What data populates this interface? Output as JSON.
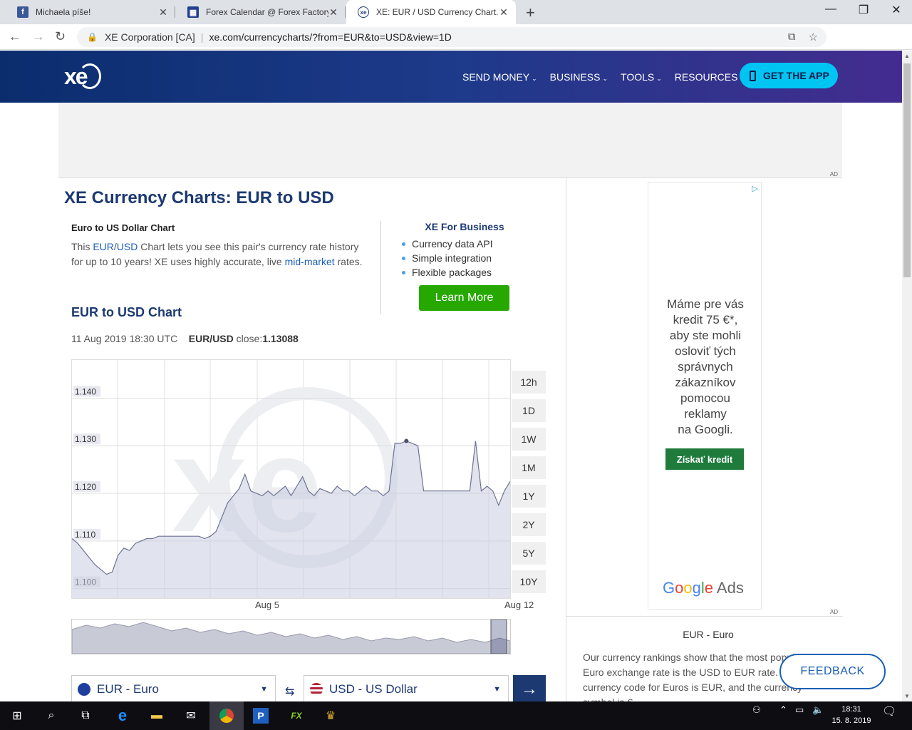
{
  "browser": {
    "tabs": [
      {
        "title": "Michaela píše!",
        "icon": "facebook-icon",
        "color": "#3b5998"
      },
      {
        "title": "Forex Calendar @ Forex Factory",
        "icon": "forexfactory-icon",
        "color": "#243f8f"
      },
      {
        "title": "XE: EUR / USD Currency Chart. Eu",
        "icon": "xe-icon",
        "color": "#1c3972"
      }
    ],
    "active_tab": 2,
    "org": "XE Corporation [CA]",
    "url": "xe.com/currencycharts/?from=EUR&to=USD&view=1D"
  },
  "header": {
    "logo": "xe",
    "nav": [
      "SEND MONEY",
      "BUSINESS",
      "TOOLS",
      "RESOURCES"
    ],
    "cta": "GET THE APP"
  },
  "ad_label": "AD",
  "main": {
    "title": "XE Currency Charts: EUR to USD",
    "intro_heading": "Euro to US Dollar Chart",
    "intro_pre": "This ",
    "intro_link1": "EUR",
    "intro_slash": "/",
    "intro_link2": "USD",
    "intro_mid": " Chart lets you see this pair's currency rate history for up to 10 years! XE uses highly accurate, live ",
    "intro_link3": "mid-market",
    "intro_post": " rates.",
    "business": {
      "title": "XE For Business",
      "items": [
        "Currency data API",
        "Simple integration",
        "Flexible packages"
      ],
      "button": "Learn More"
    },
    "chart_heading": "EUR to USD Chart",
    "meta_time": "11 Aug 2019 18:30 UTC",
    "meta_pair": "EUR/USD",
    "meta_close_label": " close:",
    "meta_close_value": "1.13088",
    "range_buttons": [
      "12h",
      "1D",
      "1W",
      "1M",
      "1Y",
      "2Y",
      "5Y",
      "10Y"
    ],
    "from_currency": "EUR - Euro",
    "to_currency": "USD - US Dollar"
  },
  "chart_data": {
    "type": "area",
    "yticks": [
      "1.140",
      "1.130",
      "1.120",
      "1.110",
      "1.100"
    ],
    "ylim": [
      1.098,
      1.148
    ],
    "xlabels": [
      "Aug 5",
      "Aug 12"
    ],
    "series": [
      {
        "values": [
          1.1105,
          1.1095,
          1.108,
          1.1065,
          1.105,
          1.104,
          1.103,
          1.1035,
          1.107,
          1.1085,
          1.108,
          1.1095,
          1.11,
          1.1105,
          1.1105,
          1.111,
          1.111,
          1.111,
          1.111,
          1.111,
          1.111,
          1.111,
          1.111,
          1.1105,
          1.111,
          1.112,
          1.115,
          1.118,
          1.1195,
          1.121,
          1.124,
          1.1205,
          1.12,
          1.1195,
          1.1205,
          1.1195,
          1.1205,
          1.1215,
          1.1195,
          1.1215,
          1.1235,
          1.1205,
          1.1195,
          1.121,
          1.1205,
          1.12,
          1.1215,
          1.1205,
          1.1205,
          1.1195,
          1.1205,
          1.1215,
          1.1205,
          1.1205,
          1.1195,
          1.1205,
          1.1305,
          1.1305,
          1.131,
          1.1305,
          1.13,
          1.1205,
          1.1205,
          1.1205,
          1.1205,
          1.1205,
          1.1205,
          1.1205,
          1.1205,
          1.1205,
          1.131,
          1.1205,
          1.1215,
          1.1205,
          1.1175,
          1.1205,
          1.1225
        ]
      }
    ]
  },
  "right": {
    "ad_text": [
      "Máme pre vás",
      "kredit 75 €*,",
      "aby ste mohli",
      "osloviť tých",
      "správnych",
      "zákazníkov",
      "pomocou",
      "reklamy",
      "na Googli."
    ],
    "ad_button": "Získať kredit",
    "ad_brand": "Google Ads",
    "currency_heading": "EUR - Euro",
    "currency_text": "Our currency rankings show that the most popular Euro exchange rate is the USD to EUR rate. The currency code for Euros is EUR, and the currency symbol is €."
  },
  "feedback": "FEEDBACK",
  "taskbar": {
    "time": "18:31",
    "date": "15. 8. 2019"
  }
}
